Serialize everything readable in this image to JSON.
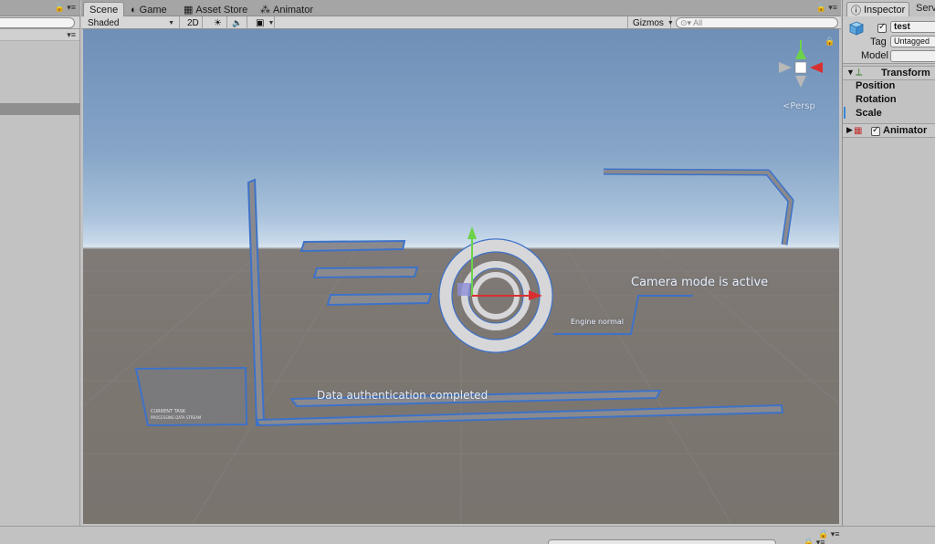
{
  "hierarchy": {
    "window_controls": "🔒 ▾≡",
    "create_dropdown": "▾≡"
  },
  "scene_tabs": [
    {
      "label": "Scene",
      "icon": "scene-icon",
      "glyph": "#"
    },
    {
      "label": "Game",
      "icon": "game-icon",
      "glyph": "◐"
    },
    {
      "label": "Asset Store",
      "icon": "store-icon",
      "glyph": "▦"
    },
    {
      "label": "Animator",
      "icon": "animator-icon",
      "glyph": "⁂"
    }
  ],
  "scene_window_controls": "🔒 ▾≡",
  "scene_toolbar": {
    "shading_mode": "Shaded",
    "mode_2d": "2D",
    "lighting_glyph": "☀",
    "audio_glyph": "🔈",
    "effects_glyph": "▣",
    "gizmos_label": "Gizmos",
    "search_placeholder": "All",
    "search_glyph": "⊙▾"
  },
  "viewport": {
    "persp_label": "Persp",
    "labels": {
      "camera_mode": "Camera mode is active",
      "engine_normal": "Engine normal",
      "data_auth": "Data authentication completed",
      "panel_small_text_1": "CURRENT TASK",
      "panel_small_text_2": "PROCESSING DATA STREAM"
    },
    "colors": {
      "outline": "#3d72c8",
      "bar_fill": "#8a8a8e",
      "ring_fill": "#d7d7d9",
      "sky_top": "#6f8fb7",
      "ground": "#7d7772",
      "gizmo_y": "#6cd24a",
      "gizmo_x": "#d83030"
    }
  },
  "inspector": {
    "tab_label": "Inspector",
    "tab_glyph": "ⓘ",
    "second_tab_label": "Serv",
    "object_name": "test",
    "active": true,
    "tag_label": "Tag",
    "tag_value": "Untagged",
    "model_label": "Model",
    "model_value": "",
    "transform": {
      "label": "Transform",
      "position_label": "Position",
      "rotation_label": "Rotation",
      "scale_label": "Scale"
    },
    "animator": {
      "label": "Animator",
      "enabled": true
    }
  },
  "bottom_bar": {
    "controls_left": "🔒 ▾≡",
    "controls_right": "🔒 ▾≡"
  }
}
